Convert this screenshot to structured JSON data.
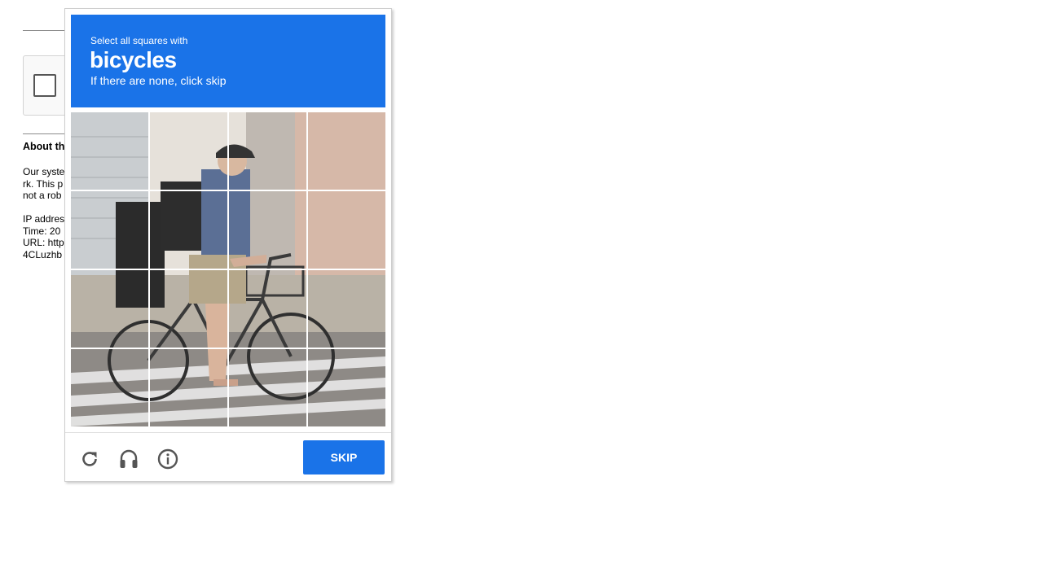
{
  "background_page": {
    "heading": "About th",
    "paragraph_lines": [
      "Our syste",
      "rk. This p",
      "not a rob"
    ],
    "info_lines": [
      "IP addres",
      "Time: 20",
      "URL: http",
      "4CLuzhb"
    ]
  },
  "challenge": {
    "instruction_small": "Select all squares with",
    "target_object": "bicycles",
    "instruction_sub": "If there are none, click skip",
    "grid": {
      "rows": 4,
      "cols": 4
    },
    "footer": {
      "reload_icon": "reload-icon",
      "audio_icon": "headphones-icon",
      "info_icon": "info-icon",
      "skip_label": "SKIP"
    }
  },
  "colors": {
    "accent": "#1a73e8",
    "header_text": "#ffffff",
    "icon_gray": "#555555"
  }
}
